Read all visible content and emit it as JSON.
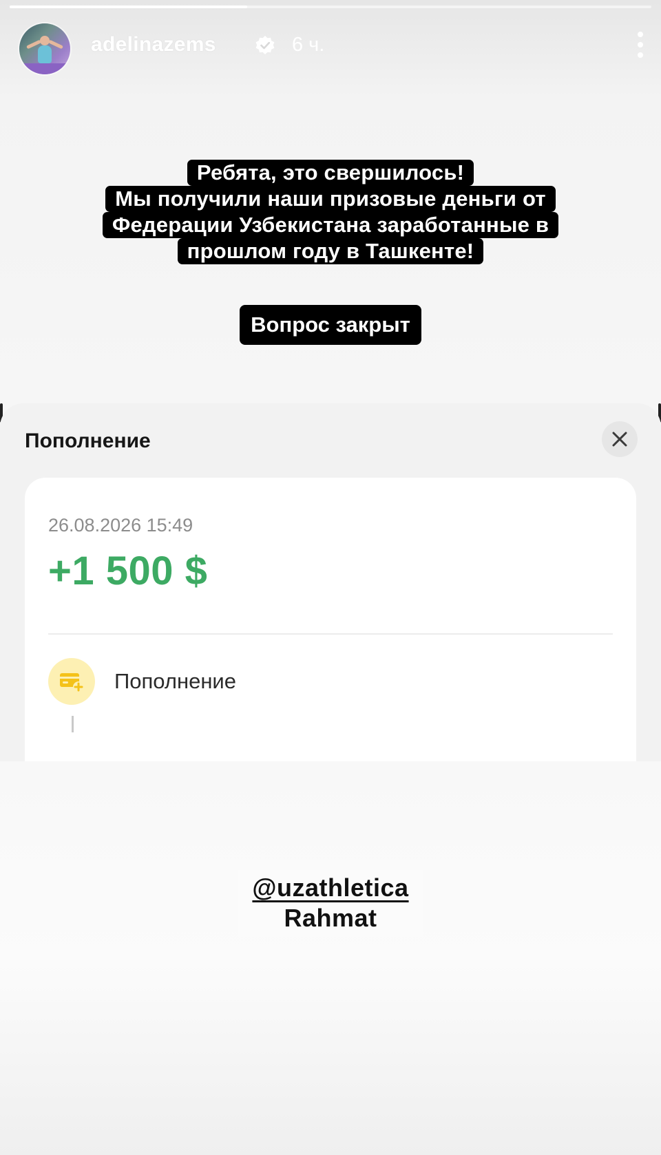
{
  "story": {
    "progress": 0.37,
    "username": "adelinazems",
    "time_ago": "6 ч.",
    "verified": true
  },
  "caption": {
    "lines": [
      "Ребята, это свершилось!",
      "Мы получили наши призовые деньги от",
      "Федерации Узбекистана заработанные в",
      "прошлом году в Ташкенте!"
    ],
    "closed": "Вопрос закрыт"
  },
  "transaction": {
    "title": "Пополнение",
    "datetime": "26.08.2026 15:49",
    "amount": "+1 500 $",
    "amount_color": "#3daa63",
    "operation_label": "Пополнение",
    "operation_icon": "card-plus-icon",
    "close_icon": "close-icon"
  },
  "mention": {
    "handle": "@uzathletica",
    "text": "Rahmat"
  }
}
